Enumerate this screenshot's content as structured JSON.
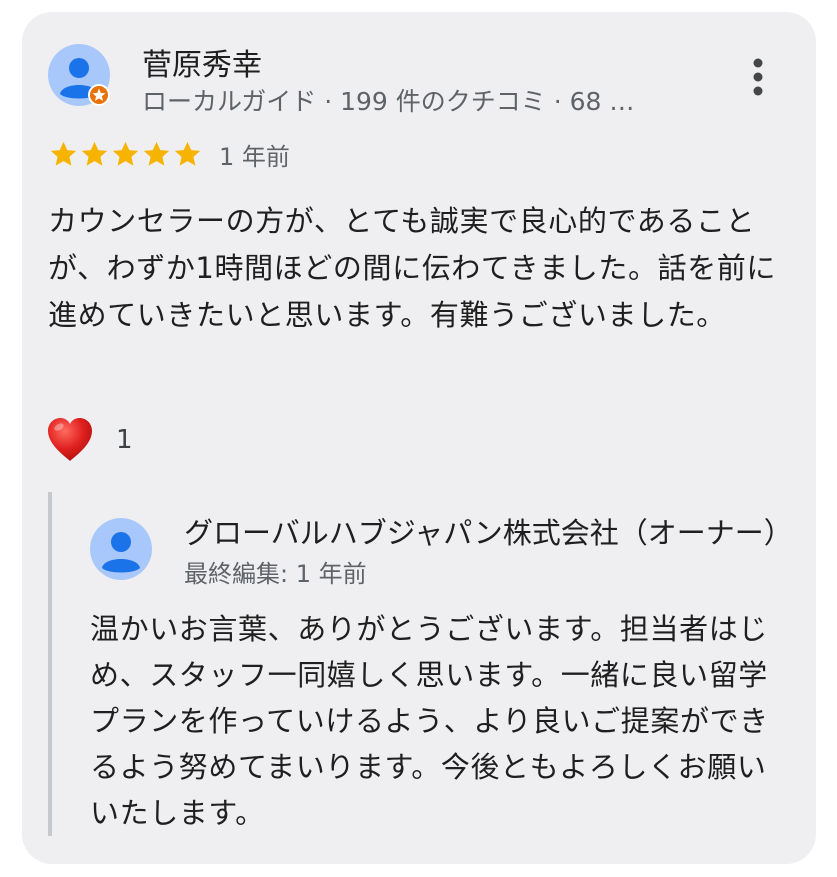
{
  "review": {
    "reviewer_name": "菅原秀幸",
    "reviewer_meta": "ローカルガイド · 199 件のクチコミ · 68 …",
    "avatar_icon": "local-guide-avatar-icon",
    "more_icon": "more-vert-icon",
    "rating": 5,
    "rating_max": 5,
    "time": "1 年前",
    "body": "カウンセラーの方が、とても誠実で良心的であることが、わずか1時間ほどの間に伝わてきました。話を前に進めていきたいと思います。有難うございました。",
    "reaction_icon": "heart-icon",
    "reaction_count": "1"
  },
  "owner_reply": {
    "name": "グローバルハブジャパン株式会社（オーナー）",
    "meta": "最終編集: 1 年前",
    "avatar_icon": "owner-avatar-icon",
    "body": "温かいお言葉、ありがとうございます。担当者はじめ、スタッフ一同嬉しく思います。一緒に良い留学プランを作っていけるよう、より良いご提案ができるよう努めてまいります。今後ともよろしくお願いいたします。"
  },
  "colors": {
    "card_background": "#efeff1",
    "star": "#f6b400",
    "avatar_bg": "#a8c7fa",
    "avatar_fg": "#1a73e8",
    "local_guide_badge": "#e8710a",
    "heart": "#e0201f"
  }
}
